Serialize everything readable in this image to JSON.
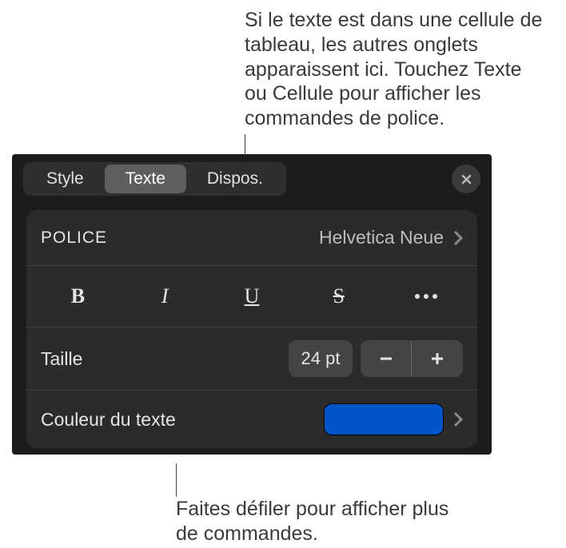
{
  "annotations": {
    "top": "Si le texte est dans une cellule de tableau, les autres onglets apparaissent ici. Touchez Texte ou Cellule pour afficher les commandes de police.",
    "bottom": "Faites défiler pour afficher plus de commandes."
  },
  "tabs": {
    "style": "Style",
    "text": "Texte",
    "layout": "Dispos."
  },
  "font_row": {
    "label": "Police",
    "value": "Helvetica Neue"
  },
  "styles": {
    "bold": "B",
    "italic": "I",
    "underline": "U",
    "strike": "S"
  },
  "size_row": {
    "label": "Taille",
    "value": "24 pt"
  },
  "color_row": {
    "label": "Couleur du texte",
    "swatch_color": "#0055c9"
  }
}
